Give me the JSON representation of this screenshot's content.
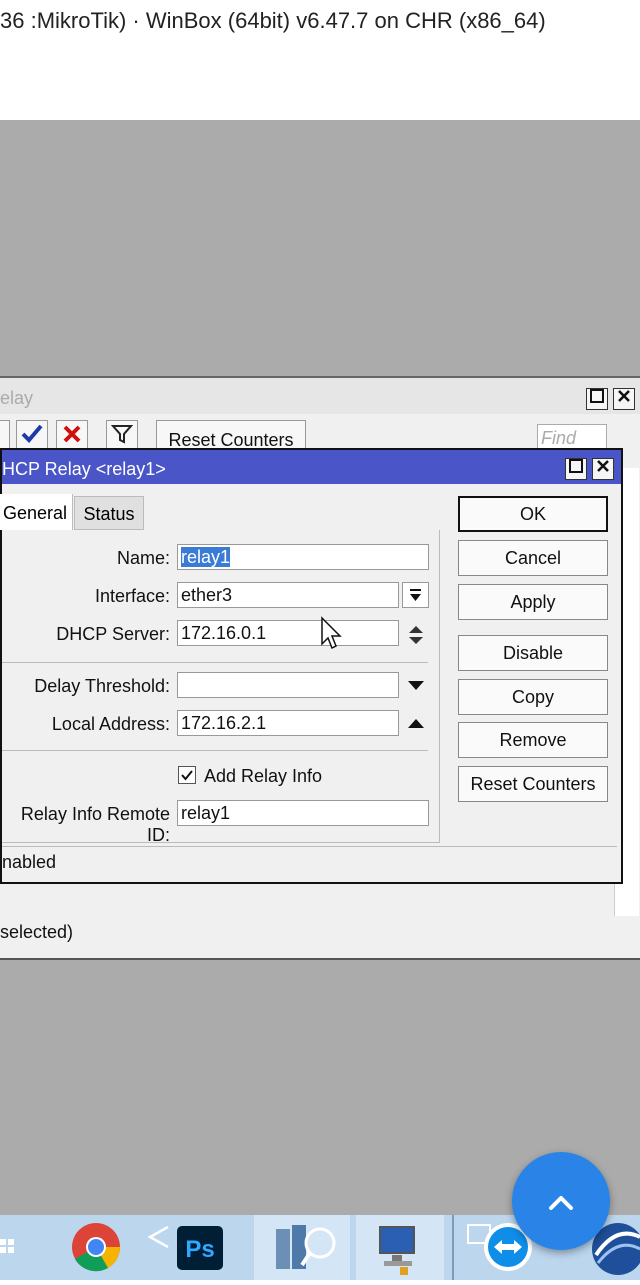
{
  "app": {
    "title": "36 :MikroTik) · WinBox (64bit) v6.47.7 on CHR (x86_64)"
  },
  "relay_window": {
    "title": "elay",
    "toolbar": {
      "reset_counters_label": "Reset Counters",
      "find_placeholder": "Find"
    },
    "status_text": "selected)"
  },
  "dialog": {
    "title": "HCP Relay <relay1>",
    "tabs": [
      {
        "label": "General"
      },
      {
        "label": "Status"
      }
    ],
    "fields": {
      "name": {
        "label": "Name:",
        "value": "relay1"
      },
      "interface": {
        "label": "Interface:",
        "value": "ether3"
      },
      "dhcp_server": {
        "label": "DHCP Server:",
        "value": "172.16.0.1"
      },
      "delay_threshold": {
        "label": "Delay Threshold:",
        "value": ""
      },
      "local_address": {
        "label": "Local Address:",
        "value": "172.16.2.1"
      },
      "add_relay_info": {
        "label": "Add Relay Info",
        "checked": true
      },
      "relay_info_remote_id": {
        "label": "Relay Info Remote ID:",
        "value": "relay1"
      }
    },
    "buttons": {
      "ok": "OK",
      "cancel": "Cancel",
      "apply": "Apply",
      "disable": "Disable",
      "copy": "Copy",
      "remove": "Remove",
      "reset_counters": "Reset Counters"
    },
    "status_text": "nabled"
  },
  "colors": {
    "dialog_title_bg": "#4a56c8",
    "fab_bg": "#2a84e8",
    "taskbar_bg": "#bcd6ee"
  }
}
